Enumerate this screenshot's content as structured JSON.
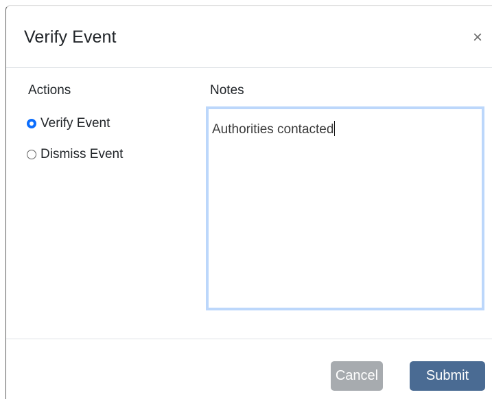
{
  "dialog": {
    "title": "Verify Event",
    "close_label": "×"
  },
  "actions": {
    "label": "Actions",
    "options": [
      {
        "label": "Verify Event",
        "checked": true
      },
      {
        "label": "Dismiss Event",
        "checked": false
      }
    ]
  },
  "notes": {
    "label": "Notes",
    "value": "Authorities contacted"
  },
  "footer": {
    "cancel_label": "Cancel",
    "submit_label": "Submit"
  },
  "colors": {
    "submit": "#4a6b93",
    "cancel": "#a7abaf",
    "focus_ring": "#bcd7fb",
    "radio_checked": "#0d6efd"
  }
}
